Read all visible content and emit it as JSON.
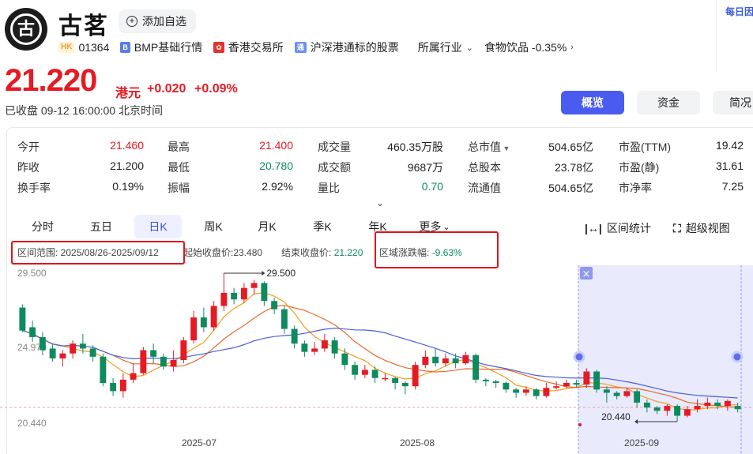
{
  "header": {
    "logo_text": "古",
    "name": "古茗",
    "add_watch_label": "添加自选",
    "market_badge": "HK",
    "code": "01364",
    "bmp_label": "BMP基础行情",
    "exchange_label": "香港交易所",
    "connect_label": "沪深港通标的股票",
    "industry_label": "所属行业",
    "sector_label": "食物饮品 -0.35%",
    "side_label": "每日因"
  },
  "quote": {
    "price": "21.220",
    "unit": "港元",
    "change": "+0.020",
    "change_pct": "+0.09%",
    "status": "已收盘  09-12 16:00:00 北京时间"
  },
  "top_tabs": {
    "overview": "概览",
    "fund": "资金",
    "brief": "简况"
  },
  "stats": {
    "open_label": "今开",
    "open": "21.460",
    "high_label": "最高",
    "high": "21.400",
    "volume_label": "成交量",
    "volume": "460.35万股",
    "mktcap_label": "总市值",
    "mktcap": "504.65亿",
    "pe_ttm_label": "市盈(TTM)",
    "pe_ttm": "19.42",
    "prev_label": "昨收",
    "prev": "21.200",
    "low_label": "最低",
    "low": "20.780",
    "turnover_label": "成交额",
    "turnover": "9687万",
    "shares_label": "总股本",
    "shares": "23.78亿",
    "pe_static_label": "市盈(静)",
    "pe_static": "31.61",
    "turnrate_label": "换手率",
    "turnrate": "0.19%",
    "amp_label": "振幅",
    "amp": "2.92%",
    "vol_ratio_label": "量比",
    "vol_ratio": "0.70",
    "float_label": "流通值",
    "float": "504.65亿",
    "pb_label": "市净率",
    "pb": "7.25"
  },
  "kline_tabs": [
    "分时",
    "五日",
    "日K",
    "周K",
    "月K",
    "季K",
    "年K",
    "更多"
  ],
  "tools": {
    "range_stats": "区间统计",
    "super_view": "超级视图"
  },
  "range": {
    "range_text": "区间范围: 2025/08/26-2025/09/12",
    "start_text": "起始收盘价:23.480",
    "end_label": "结束收盘价:",
    "end_value": "21.220",
    "change_label": "区域涨跌幅:",
    "change_value": "-9.63%"
  },
  "colors": {
    "up": "#e41b23",
    "down": "#0f8a5f",
    "accent": "#4a5cf0",
    "ma5": "#f0a020",
    "ma10": "#e86a2c",
    "ma20": "#4a5fd8"
  },
  "chart_data": {
    "type": "candlestick",
    "ylabels": [
      "29.500",
      "24.970",
      "20.440"
    ],
    "ylim": [
      20.44,
      29.5
    ],
    "xlabels": [
      "2025-07",
      "2025-08",
      "2025-09"
    ],
    "max_marker": "29.500",
    "min_marker": "20.440",
    "candles": [
      [
        27.4,
        26.0,
        27.6,
        25.9
      ],
      [
        26.2,
        25.6,
        26.6,
        25.3
      ],
      [
        25.6,
        24.8,
        25.9,
        24.5
      ],
      [
        24.9,
        24.3,
        25.2,
        24.1
      ],
      [
        24.3,
        24.6,
        24.8,
        23.8
      ],
      [
        24.6,
        25.2,
        25.4,
        24.3
      ],
      [
        25.2,
        24.9,
        25.8,
        24.6
      ],
      [
        24.9,
        24.4,
        25.1,
        24.1
      ],
      [
        24.4,
        22.8,
        24.6,
        22.6
      ],
      [
        22.8,
        22.3,
        23.1,
        22.0
      ],
      [
        22.3,
        23.0,
        23.4,
        21.9
      ],
      [
        23.0,
        23.4,
        24.0,
        22.8
      ],
      [
        23.4,
        24.8,
        25.0,
        23.3
      ],
      [
        24.8,
        24.4,
        25.2,
        24.0
      ],
      [
        24.4,
        23.8,
        24.6,
        23.6
      ],
      [
        23.8,
        24.2,
        24.8,
        23.5
      ],
      [
        24.2,
        25.4,
        25.6,
        24.0
      ],
      [
        25.4,
        26.8,
        27.2,
        25.2
      ],
      [
        26.8,
        26.2,
        27.4,
        25.9
      ],
      [
        26.2,
        27.5,
        27.8,
        26.0
      ],
      [
        27.5,
        28.3,
        29.5,
        27.2
      ],
      [
        28.3,
        27.9,
        28.6,
        27.6
      ],
      [
        27.9,
        28.6,
        28.9,
        27.7
      ],
      [
        28.6,
        28.9,
        29.1,
        28.2
      ],
      [
        28.9,
        27.8,
        29.0,
        27.5
      ],
      [
        27.8,
        27.3,
        28.0,
        27.0
      ],
      [
        27.3,
        26.1,
        27.5,
        25.8
      ],
      [
        26.1,
        25.2,
        26.3,
        24.9
      ],
      [
        25.2,
        24.7,
        25.4,
        24.4
      ],
      [
        24.7,
        24.9,
        25.3,
        24.5
      ],
      [
        24.9,
        25.4,
        25.8,
        24.7
      ],
      [
        25.4,
        24.6,
        25.6,
        24.3
      ],
      [
        24.6,
        23.9,
        24.9,
        23.6
      ],
      [
        23.9,
        23.3,
        24.1,
        23.0
      ],
      [
        23.3,
        23.6,
        23.9,
        23.1
      ],
      [
        23.6,
        23.1,
        23.8,
        22.8
      ],
      [
        23.1,
        23.1,
        23.4,
        22.9
      ],
      [
        23.1,
        22.8,
        23.2,
        22.4
      ],
      [
        22.8,
        22.6,
        22.9,
        22.1
      ],
      [
        22.6,
        23.9,
        24.1,
        22.4
      ],
      [
        23.9,
        24.4,
        24.8,
        23.7
      ],
      [
        24.4,
        24.0,
        24.9,
        23.8
      ],
      [
        24.0,
        24.3,
        24.6,
        23.8
      ],
      [
        24.3,
        24.0,
        24.6,
        23.7
      ],
      [
        24.0,
        24.5,
        24.7,
        23.9
      ],
      [
        24.5,
        23.0,
        24.6,
        22.8
      ],
      [
        23.0,
        22.9,
        23.1,
        22.6
      ],
      [
        22.9,
        22.8,
        23.0,
        22.5
      ],
      [
        22.8,
        22.4,
        22.9,
        22.2
      ],
      [
        22.4,
        22.2,
        22.5,
        21.9
      ],
      [
        22.2,
        22.4,
        22.6,
        22.0
      ],
      [
        22.4,
        22.0,
        22.5,
        21.8
      ],
      [
        22.0,
        22.5,
        22.8,
        21.9
      ],
      [
        22.5,
        22.6,
        22.9,
        22.4
      ],
      [
        22.6,
        22.8,
        23.0,
        22.5
      ],
      [
        22.8,
        22.7,
        23.0,
        22.5
      ],
      [
        22.7,
        23.5,
        23.7,
        22.5
      ],
      [
        23.5,
        22.4,
        23.6,
        22.2
      ],
      [
        22.4,
        22.2,
        22.6,
        21.6
      ],
      [
        22.2,
        22.0,
        22.3,
        21.8
      ],
      [
        22.0,
        22.3,
        22.5,
        21.9
      ],
      [
        22.3,
        21.6,
        22.4,
        21.3
      ],
      [
        21.6,
        21.3,
        21.8,
        21.0
      ],
      [
        21.3,
        21.1,
        21.4,
        20.9
      ],
      [
        21.1,
        21.4,
        21.5,
        20.8
      ],
      [
        21.4,
        20.8,
        21.5,
        20.44
      ],
      [
        20.8,
        21.2,
        21.4,
        20.7
      ],
      [
        21.2,
        21.4,
        21.8,
        21.0
      ],
      [
        21.4,
        21.6,
        21.9,
        21.2
      ],
      [
        21.6,
        21.4,
        21.8,
        21.2
      ],
      [
        21.4,
        21.7,
        21.8,
        21.1
      ],
      [
        21.4,
        21.2,
        21.6,
        21.0
      ]
    ],
    "selected_range_start_index": 56,
    "selected_range_end_index": 71
  }
}
